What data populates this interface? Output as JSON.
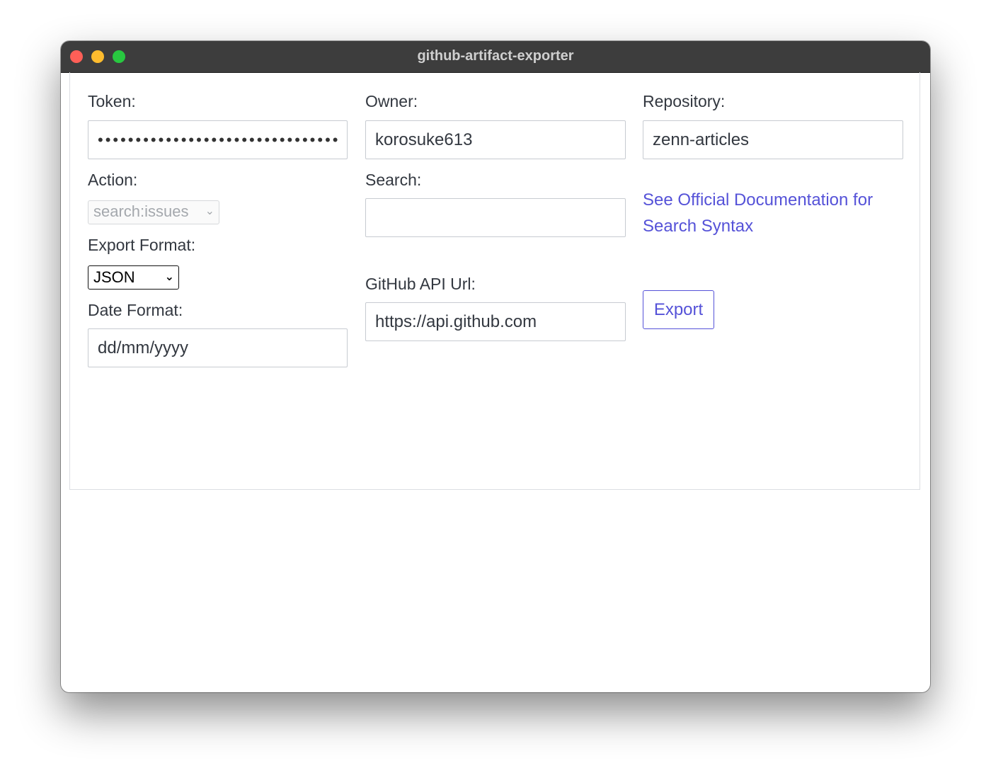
{
  "window": {
    "title": "github-artifact-exporter"
  },
  "form": {
    "token": {
      "label": "Token:",
      "masked_value": "••••••••••••••••••••••••••••••••"
    },
    "owner": {
      "label": "Owner:",
      "value": "korosuke613"
    },
    "repository": {
      "label": "Repository:",
      "value": "zenn-articles"
    },
    "action": {
      "label": "Action:",
      "selected": "search:issues",
      "disabled": true
    },
    "search": {
      "label": "Search:",
      "value": ""
    },
    "doc_link": {
      "text": "See Official Documentation for Search Syntax"
    },
    "export_format": {
      "label": "Export Format:",
      "selected": "JSON"
    },
    "api_url": {
      "label": "GitHub API Url:",
      "value": "https://api.github.com"
    },
    "date_format": {
      "label": "Date Format:",
      "value": "dd/mm/yyyy"
    },
    "export_button": {
      "label": "Export"
    }
  },
  "icons": {
    "select_chevron": "chevron-down-icon"
  },
  "colors": {
    "titlebar": "#3d3d3d",
    "link": "#5552d8",
    "text": "#333840",
    "traffic_close": "#ff5f57",
    "traffic_minimize": "#febc2e",
    "traffic_maximize": "#28c840"
  }
}
